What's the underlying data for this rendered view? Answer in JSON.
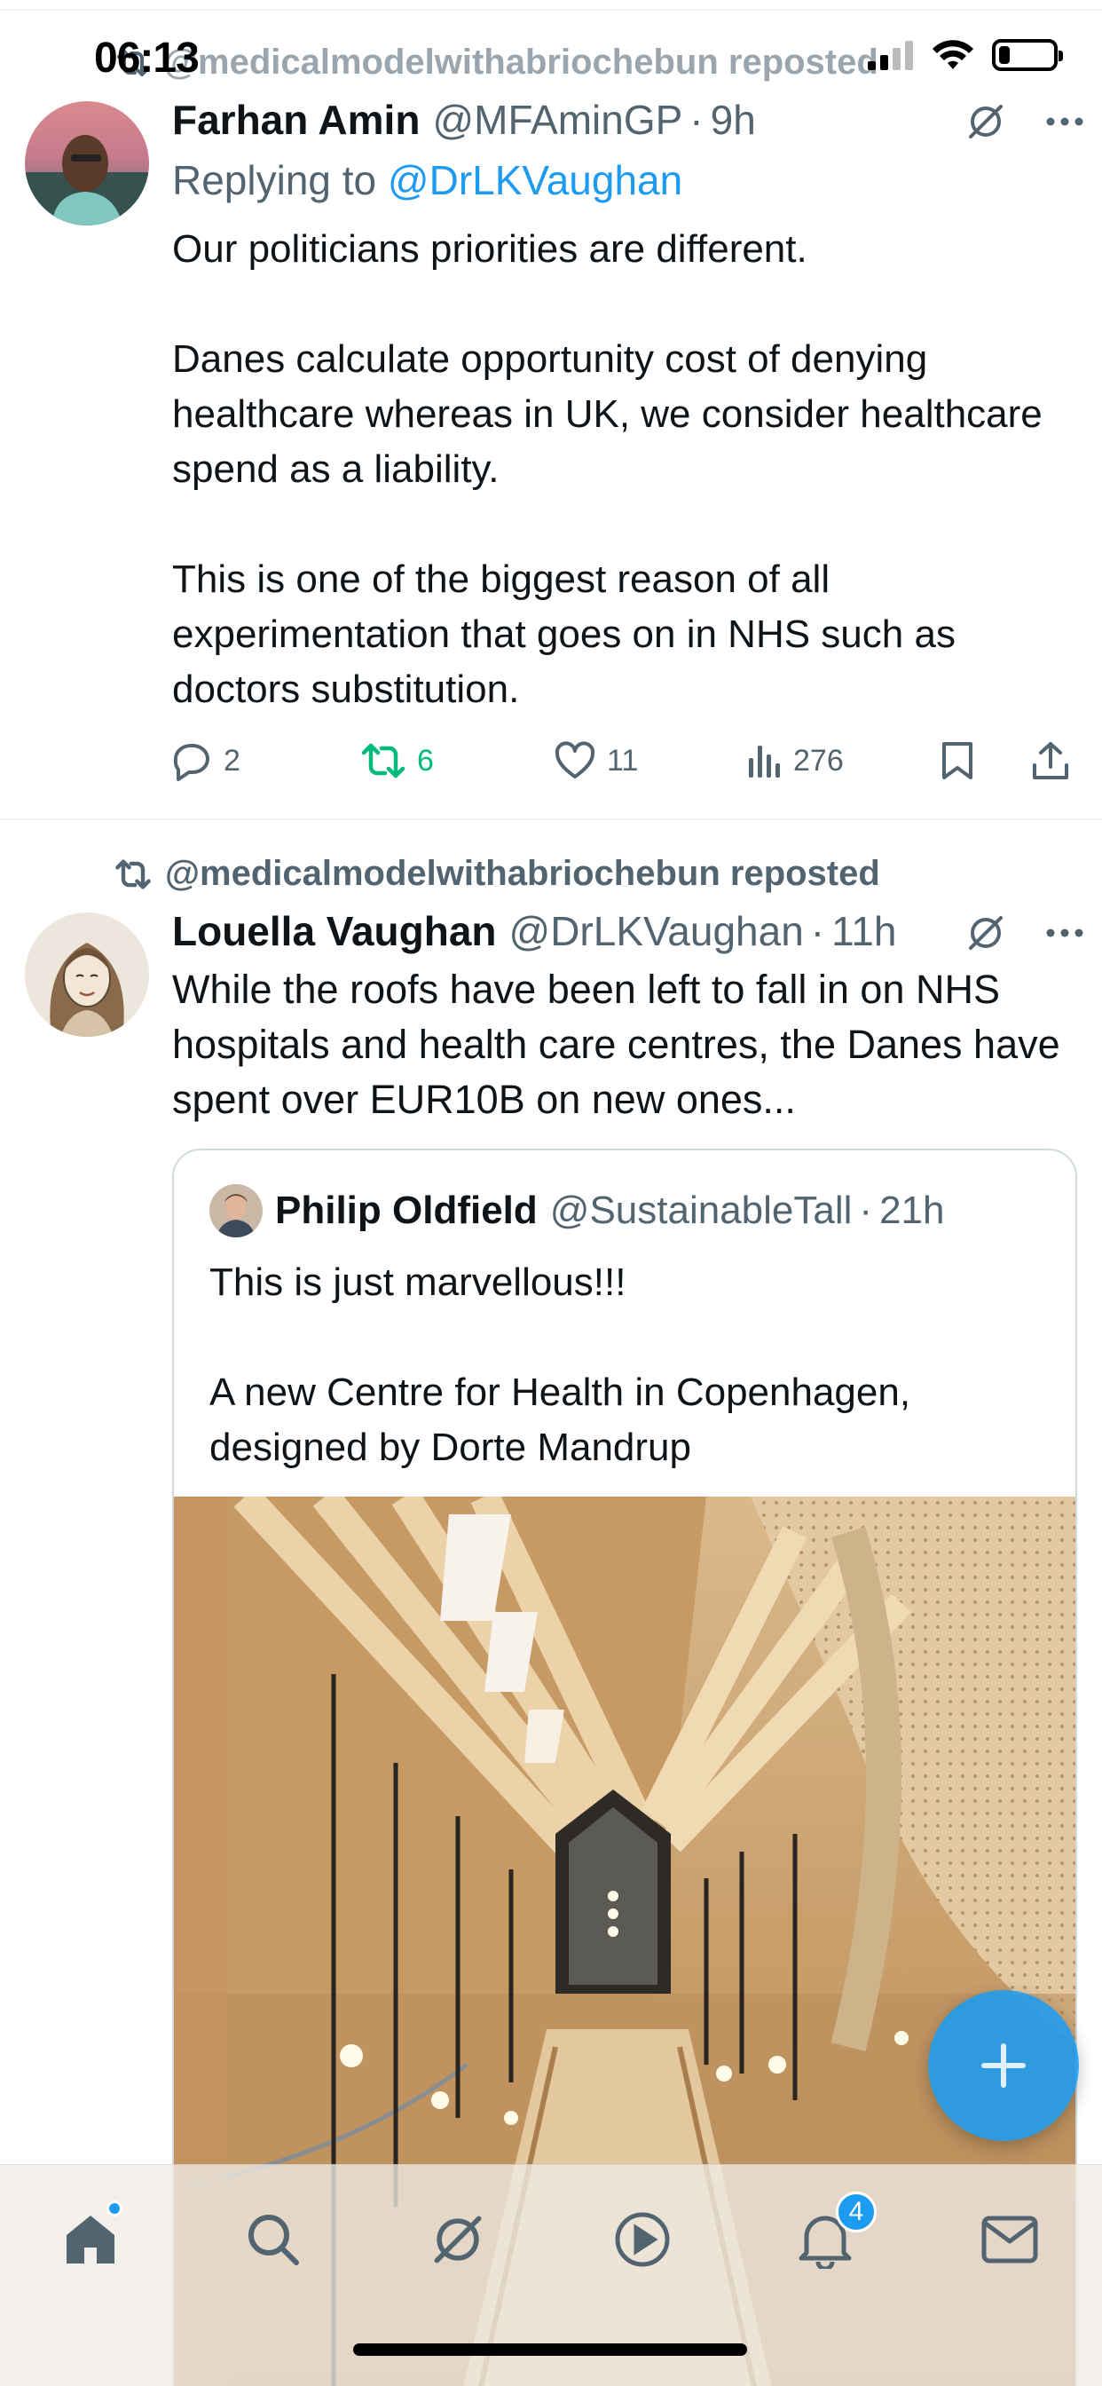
{
  "status_bar": {
    "time": "06:13"
  },
  "feed": {
    "first_tweet": {
      "repost_by": "@medicalmodelwithabriochebun reposted",
      "author_name": "Farhan Amin",
      "handle": "@MFAminGP",
      "separator": "·",
      "time": "9h",
      "replying_to_label": "Replying to",
      "replying_to_handle": "@DrLKVaughan",
      "text": "Our politicians priorities are different.\n\nDanes calculate opportunity cost of denying healthcare whereas in UK, we consider healthcare spend as a liability.\n\nThis is one of the biggest reason of all experimentation that goes on in NHS such as doctors substitution.",
      "replies": "2",
      "reposts": "6",
      "likes": "11",
      "views": "276"
    },
    "second_tweet": {
      "repost_by": "@medicalmodelwithabriochebun reposted",
      "author_name": "Louella Vaughan",
      "handle": "@DrLKVaughan",
      "separator": "·",
      "time": "11h",
      "text": "While the roofs have been left to fall in on NHS hospitals and health care centres, the Danes have spent over EUR10B on new ones...",
      "quote": {
        "author_name": "Philip Oldfield",
        "handle": "@SustainableTall",
        "separator": "·",
        "time": "21h",
        "text": "This is just marvellous!!!\n\nA new Centre for Health in Copenhagen, designed by Dorte Mandrup"
      }
    }
  },
  "tab_bar": {
    "items": [
      "home-icon",
      "search-icon",
      "grok-icon",
      "video-icon",
      "notifications-icon",
      "messages-icon"
    ],
    "notifications_badge": "4"
  },
  "colors": {
    "accent": "#1d9bf0",
    "repost_green": "#00ba7c",
    "secondary_text": "#536471",
    "primary_text": "#0f1419"
  },
  "battery_level": 0.2
}
